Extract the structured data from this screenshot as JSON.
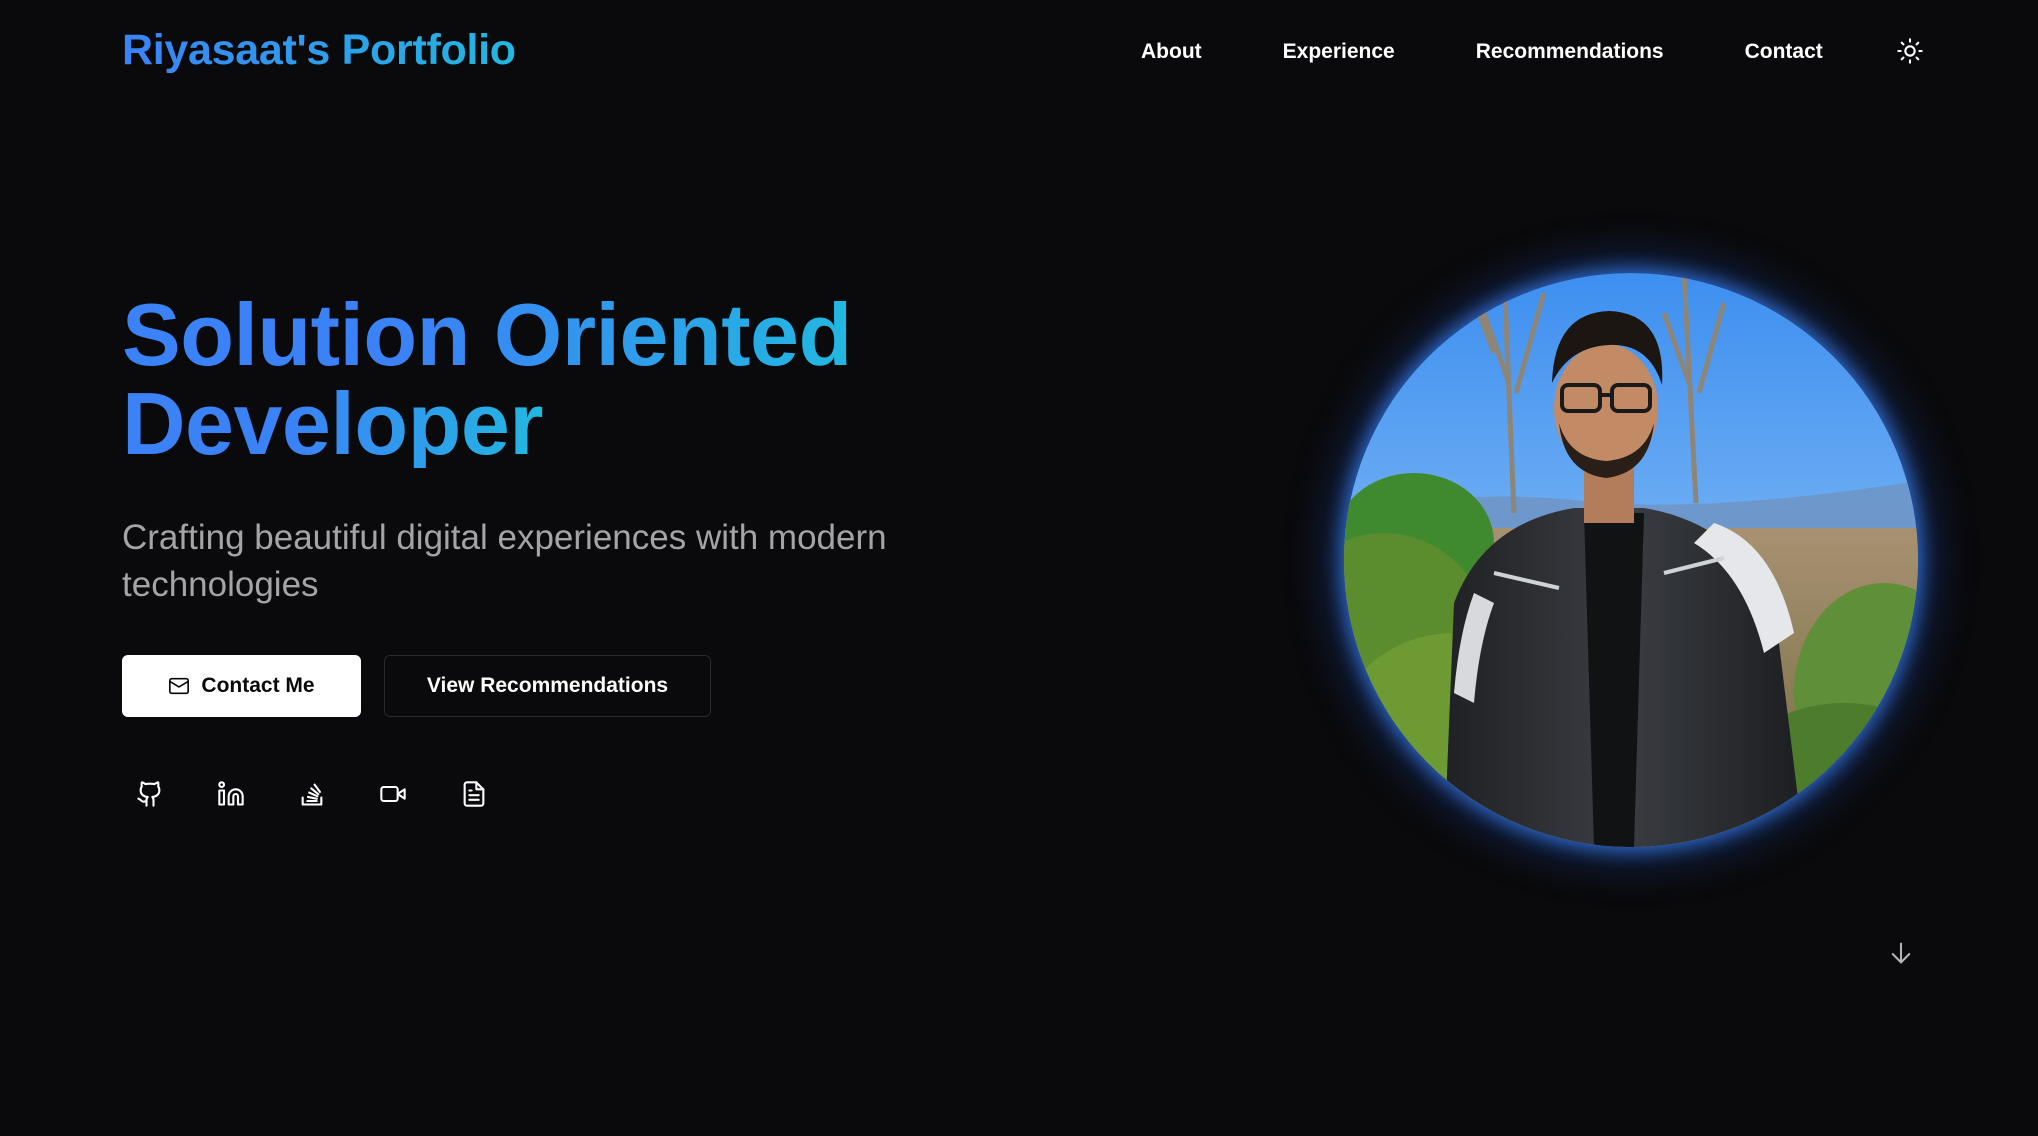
{
  "header": {
    "brand": "Riyasaat's Portfolio",
    "nav": {
      "about": "About",
      "experience": "Experience",
      "recommendations": "Recommendations",
      "contact": "Contact"
    },
    "theme_icon": "sun-icon"
  },
  "hero": {
    "title_line1": "Solution Oriented",
    "title_line2": "Developer",
    "subtitle": "Crafting beautiful digital experiences with modern technologies",
    "contact_button": "Contact Me",
    "contact_button_icon": "mail-icon",
    "recommendations_button": "View Recommendations",
    "socials": [
      {
        "icon": "github-icon"
      },
      {
        "icon": "linkedin-icon"
      },
      {
        "icon": "stackoverflow-icon"
      },
      {
        "icon": "video-icon"
      },
      {
        "icon": "document-icon"
      }
    ],
    "portrait": "profile-photo",
    "scroll_icon": "arrow-down-icon"
  },
  "colors": {
    "background": "#0a0a0c",
    "accent_blue": "#3b82f6",
    "accent_cyan": "#22b8e0",
    "subtitle_gray": "#a3a3a8"
  }
}
